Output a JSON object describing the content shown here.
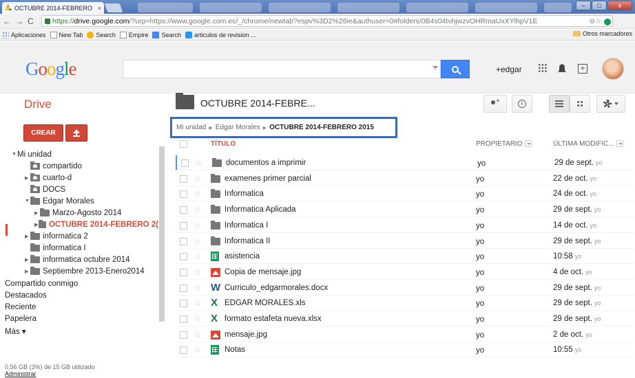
{
  "browser": {
    "tab_title": "OCTUBRE 2014-FEBRERO",
    "tab_close": "×",
    "win_min": "–",
    "win_max": "□",
    "win_close": "x",
    "nav_back": "←",
    "nav_forward": "→",
    "nav_reload": "C",
    "url_scheme": "https://",
    "url_host": "drive.google.com",
    "url_path": "/?urp=https://www.google.com.ec/_/chrome/newtab?espv%3D2%26ie&authuser=0#folders/0B4s04tvhjwzvOHRmaUxXYlhpV1E",
    "omni_icons": "⊖☆",
    "bookmarks": [
      "Aplicaciones",
      "New Tab",
      "Search",
      "Empire",
      "Search",
      "articulos de revision ..."
    ],
    "other_bookmarks": "Otros marcadores"
  },
  "google_bar": {
    "logo": [
      "G",
      "o",
      "o",
      "g",
      "l",
      "e"
    ],
    "search_value": "",
    "user_name": "+edgar",
    "share_plus": "+"
  },
  "drive": {
    "title": "Drive",
    "create_label": "CREAR",
    "current_folder": "OCTUBRE 2014-FEBRE...",
    "tree": [
      {
        "label": "Mi unidad",
        "arrow": "▼"
      },
      {
        "label": "compartido",
        "arrow": ""
      },
      {
        "label": "cuarto-d",
        "arrow": "▶"
      },
      {
        "label": "DOCS",
        "arrow": ""
      },
      {
        "label": "Edgar Morales",
        "arrow": "▼"
      },
      {
        "label": "Marzo-Agosto 2014",
        "arrow": "▶"
      },
      {
        "label": "OCTUBRE 2014-FEBRERO 2(",
        "arrow": "▶"
      },
      {
        "label": "informatica 2",
        "arrow": "▶"
      },
      {
        "label": "informatica I",
        "arrow": ""
      },
      {
        "label": "informatica octubre 2014",
        "arrow": "▶"
      },
      {
        "label": "Septiembre 2013-Enero2014",
        "arrow": "▶"
      },
      {
        "label": "Compartido conmigo",
        "arrow": ""
      },
      {
        "label": "Destacados",
        "arrow": ""
      },
      {
        "label": "Reciente",
        "arrow": ""
      },
      {
        "label": "Papelera",
        "arrow": ""
      },
      {
        "label": "Más ▾",
        "arrow": ""
      }
    ],
    "storage_text": "0,56 GB (3%) de 15 GB utilizado",
    "manage_link": "Administrar",
    "breadcrumb": [
      "Mi unidad",
      "Edgar Morales",
      "OCTUBRE 2014-FEBRERO 2015"
    ],
    "breadcrumb_sep": "▶",
    "columns": {
      "title": "TÍTULO",
      "owner": "PROPIETARIO",
      "modified": "ÚLTIMA MODIFIC..."
    },
    "files": [
      {
        "name": "documentos a imprimir",
        "type": "folder",
        "owner": "yo",
        "modified": "29 de sept.",
        "by": "yo"
      },
      {
        "name": "examenes primer parcial",
        "type": "folder",
        "owner": "yo",
        "modified": "22 de oct.",
        "by": "yo"
      },
      {
        "name": "Informatica",
        "type": "folder",
        "owner": "yo",
        "modified": "24 de oct.",
        "by": "yo"
      },
      {
        "name": "Informatica Aplicada",
        "type": "folder",
        "owner": "yo",
        "modified": "29 de sept.",
        "by": "yo"
      },
      {
        "name": "Informatica I",
        "type": "folder",
        "owner": "yo",
        "modified": "14 de oct.",
        "by": "yo"
      },
      {
        "name": "Informatica II",
        "type": "folder",
        "owner": "yo",
        "modified": "29 de sept.",
        "by": "yo"
      },
      {
        "name": "asistencia",
        "type": "sheet",
        "owner": "yo",
        "modified": "10:58",
        "by": "yo"
      },
      {
        "name": "Copia de mensaje.jpg",
        "type": "image",
        "owner": "yo",
        "modified": "4 de oct.",
        "by": "yo"
      },
      {
        "name": "Curriculo_edgarmorales.docx",
        "type": "word",
        "owner": "yo",
        "modified": "29 de sept.",
        "by": "yo"
      },
      {
        "name": "EDGAR MORALES.xls",
        "type": "excel",
        "owner": "yo",
        "modified": "29 de sept.",
        "by": "yo"
      },
      {
        "name": "formato estafeta nueva.xlsx",
        "type": "excel",
        "owner": "yo",
        "modified": "29 de sept.",
        "by": "yo"
      },
      {
        "name": "mensaje.jpg",
        "type": "image",
        "owner": "yo",
        "modified": "2 de oct.",
        "by": "yo"
      },
      {
        "name": "Notas",
        "type": "sheet",
        "owner": "yo",
        "modified": "10:55",
        "by": "yo"
      }
    ],
    "word_glyph": "W",
    "excel_glyph": "X",
    "star_glyph": "☆"
  },
  "colors": {
    "accent_red": "#dd4b39",
    "search_blue": "#4285f4",
    "highlight_box": "#3b6ab0"
  }
}
